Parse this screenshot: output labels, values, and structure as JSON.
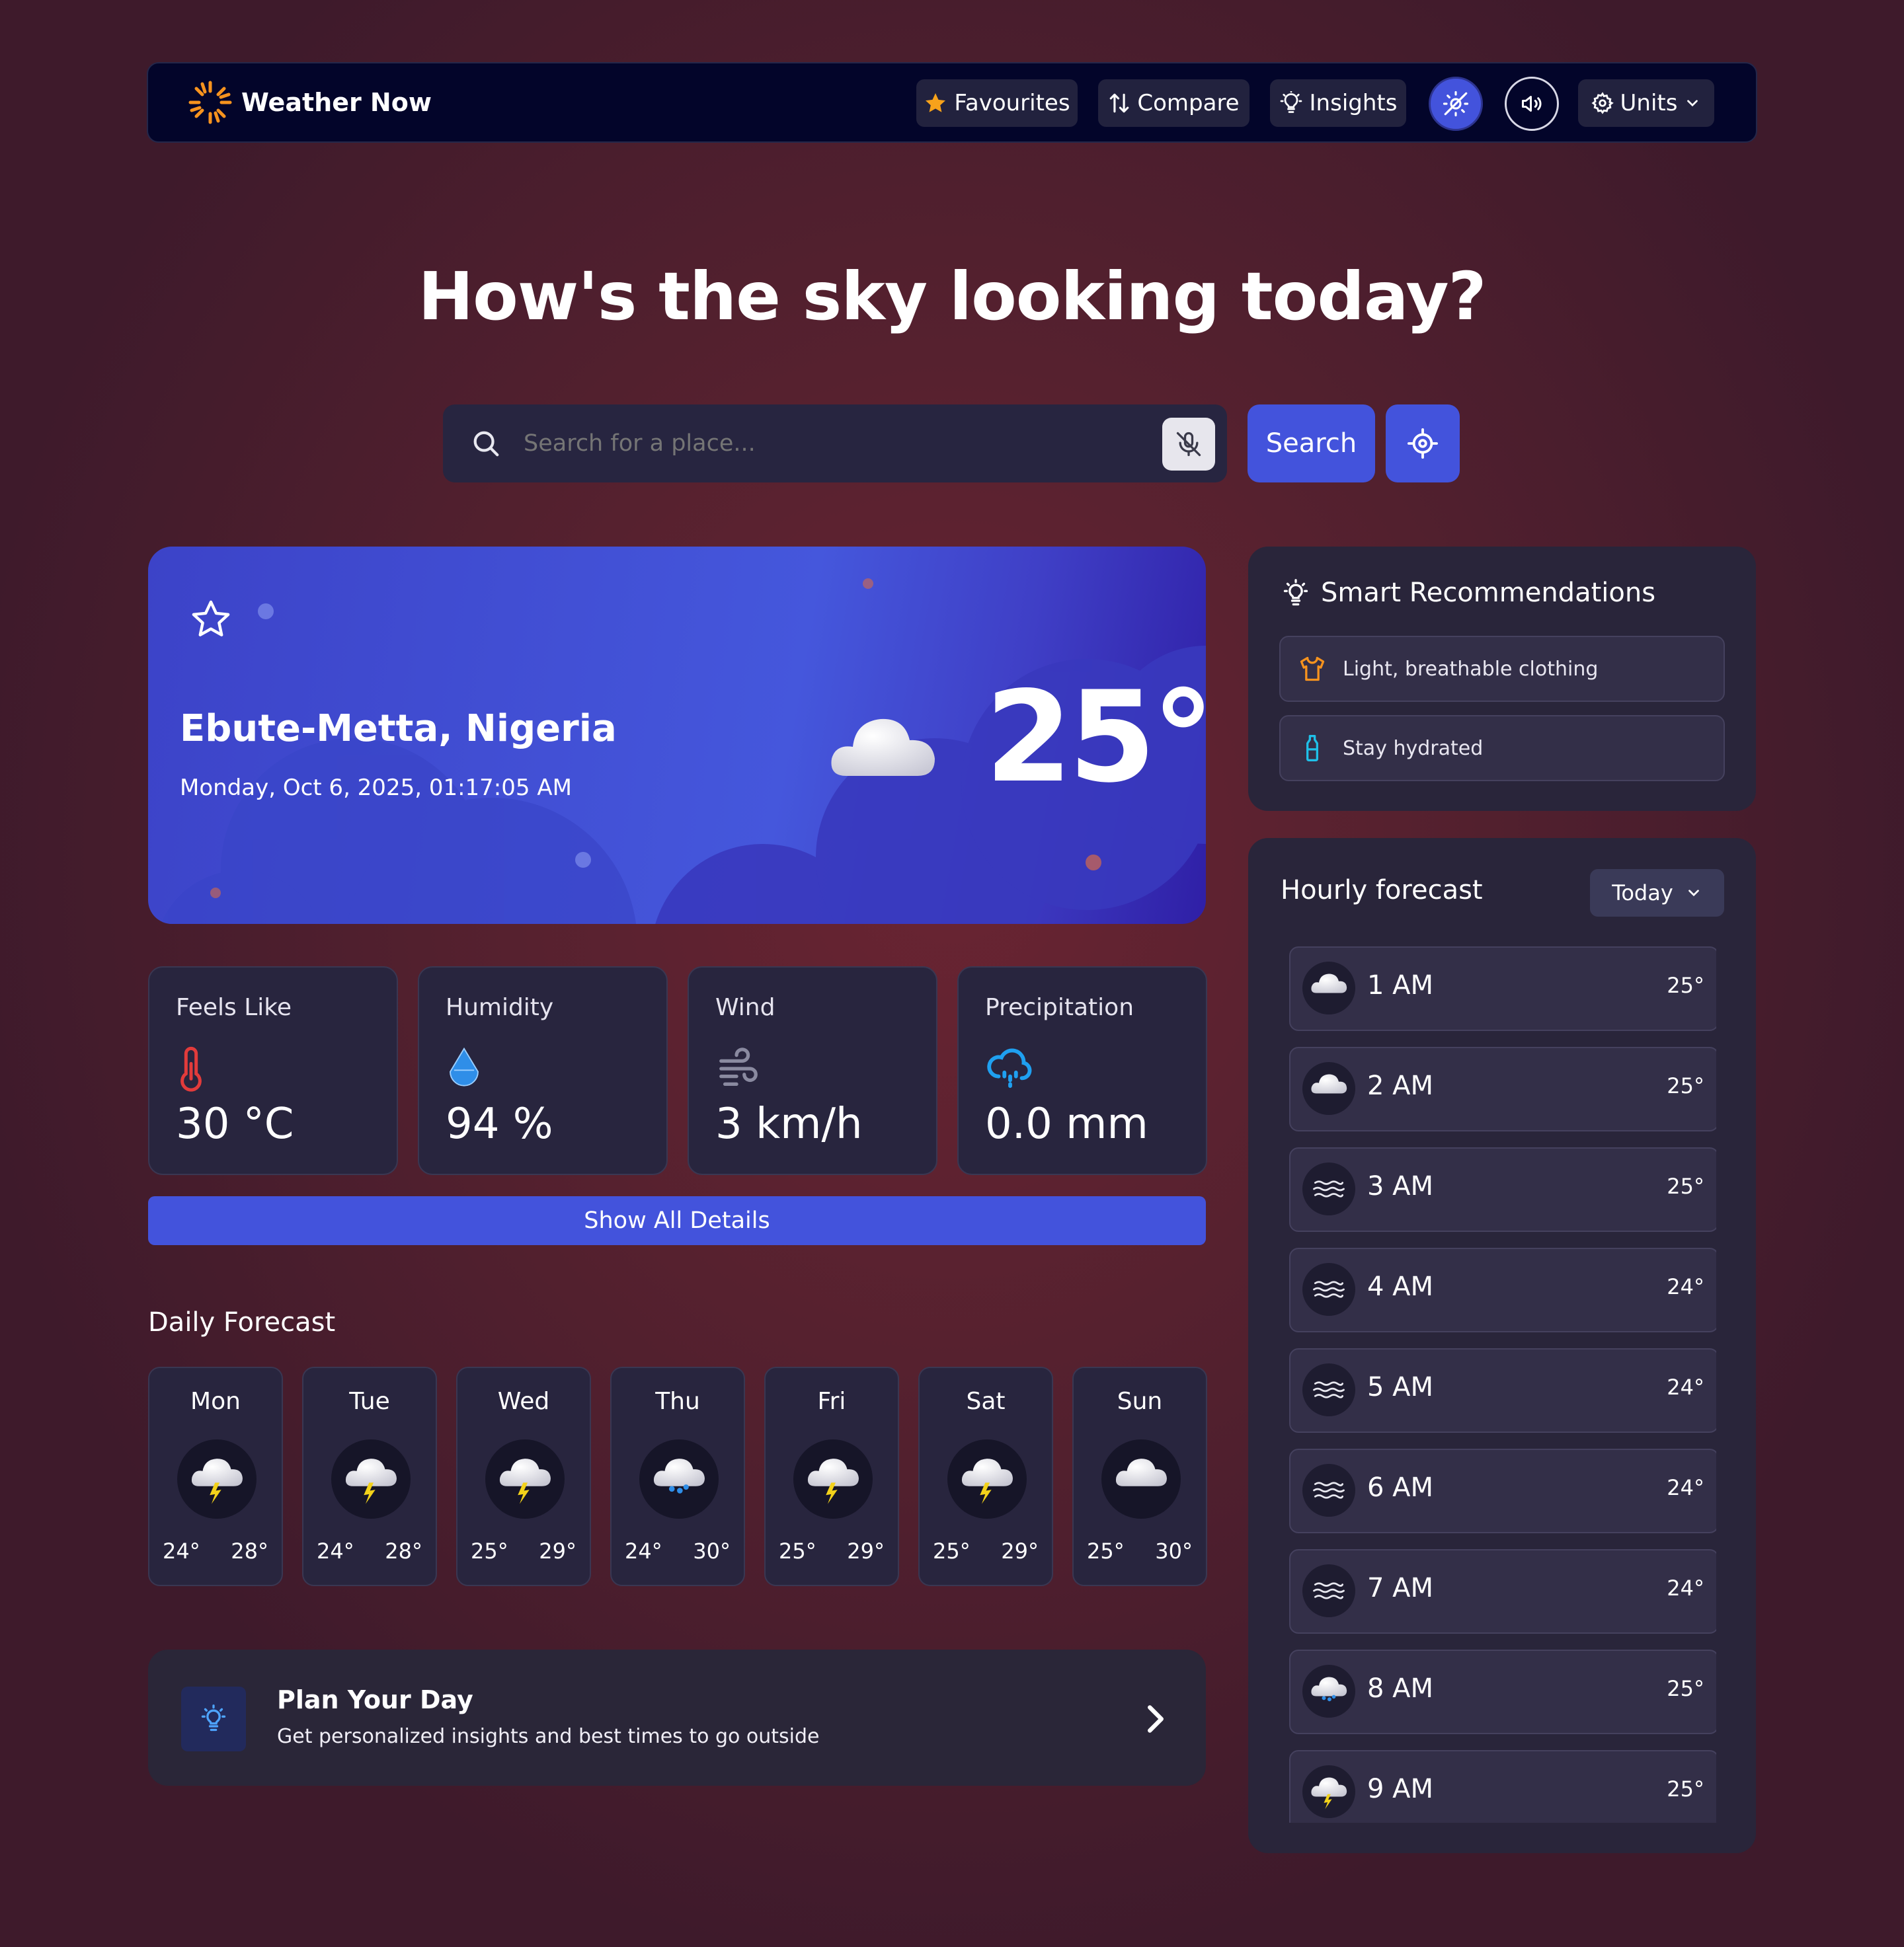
{
  "app": {
    "name": "Weather Now"
  },
  "nav": {
    "favourites": "Favourites",
    "compare": "Compare",
    "insights": "Insights",
    "units": "Units"
  },
  "hero": {
    "title": "How's the sky looking today?"
  },
  "search": {
    "placeholder": "Search for a place...",
    "button": "Search"
  },
  "current": {
    "location": "Ebute-Metta, Nigeria",
    "datetime": "Monday, Oct 6, 2025, 01:17:05 AM",
    "temperature": "25°",
    "condition_icon": "cloud-icon"
  },
  "stats": [
    {
      "label": "Feels Like",
      "value": "30 °C",
      "icon": "thermometer-icon"
    },
    {
      "label": "Humidity",
      "value": "94 %",
      "icon": "droplet-icon"
    },
    {
      "label": "Wind",
      "value": "3 km/h",
      "icon": "wind-icon"
    },
    {
      "label": "Precipitation",
      "value": "0.0 mm",
      "icon": "rain-cloud-icon"
    }
  ],
  "details_button": "Show All Details",
  "daily": {
    "title": "Daily Forecast",
    "days": [
      {
        "day": "Mon",
        "lo": "24°",
        "hi": "28°",
        "icon": "thunderstorm-icon"
      },
      {
        "day": "Tue",
        "lo": "24°",
        "hi": "28°",
        "icon": "thunderstorm-icon"
      },
      {
        "day": "Wed",
        "lo": "25°",
        "hi": "29°",
        "icon": "thunderstorm-icon"
      },
      {
        "day": "Thu",
        "lo": "24°",
        "hi": "30°",
        "icon": "rain-icon"
      },
      {
        "day": "Fri",
        "lo": "25°",
        "hi": "29°",
        "icon": "thunderstorm-icon"
      },
      {
        "day": "Sat",
        "lo": "25°",
        "hi": "29°",
        "icon": "thunderstorm-icon"
      },
      {
        "day": "Sun",
        "lo": "25°",
        "hi": "30°",
        "icon": "cloud-icon"
      }
    ]
  },
  "plan": {
    "title": "Plan Your Day",
    "subtitle": "Get personalized insights and best times to go outside"
  },
  "recommendations": {
    "title": "Smart Recommendations",
    "items": [
      {
        "text": "Light, breathable clothing",
        "icon": "shirt-icon"
      },
      {
        "text": "Stay hydrated",
        "icon": "bottle-icon"
      }
    ]
  },
  "hourly": {
    "title": "Hourly forecast",
    "selector": "Today",
    "hours": [
      {
        "time": "1 AM",
        "temp": "25°",
        "icon": "cloud-icon"
      },
      {
        "time": "2 AM",
        "temp": "25°",
        "icon": "cloud-icon"
      },
      {
        "time": "3 AM",
        "temp": "25°",
        "icon": "fog-icon"
      },
      {
        "time": "4 AM",
        "temp": "24°",
        "icon": "fog-icon"
      },
      {
        "time": "5 AM",
        "temp": "24°",
        "icon": "fog-icon"
      },
      {
        "time": "6 AM",
        "temp": "24°",
        "icon": "fog-icon"
      },
      {
        "time": "7 AM",
        "temp": "24°",
        "icon": "fog-icon"
      },
      {
        "time": "8 AM",
        "temp": "25°",
        "icon": "rain-icon"
      },
      {
        "time": "9 AM",
        "temp": "25°",
        "icon": "thunderstorm-icon"
      }
    ]
  },
  "colors": {
    "accent": "#4353dc",
    "nav_bg": "#03052a",
    "card_bg": "#28253e",
    "brand_orange": "#f7931e"
  }
}
